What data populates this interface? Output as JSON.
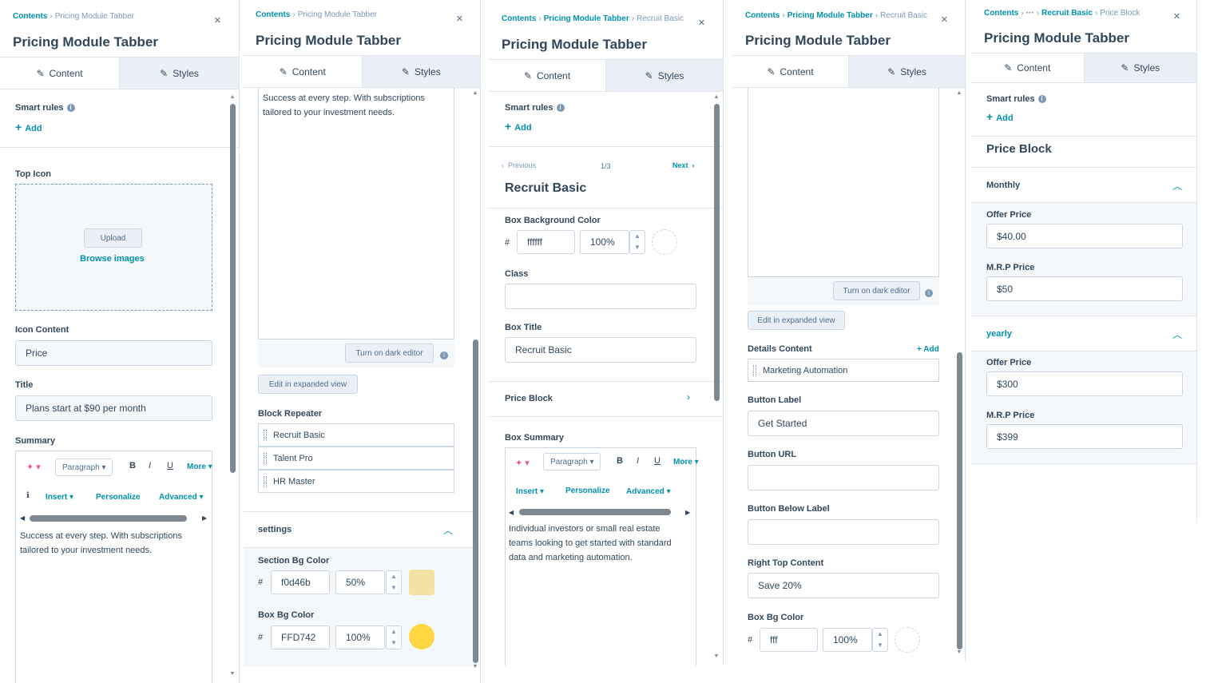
{
  "crumb_root": "Contents",
  "module_title": "Pricing Module Tabber",
  "tab_content": "Content",
  "tab_styles": "Styles",
  "smart_rules": "Smart rules",
  "add": "Add",
  "add_plus": "+ Add",
  "close_glyph": "×",
  "turn_on_dark_editor": "Turn on dark editor",
  "edit_expanded": "Edit in expanded view",
  "rte": {
    "paragraph": "Paragraph",
    "bold": "B",
    "italic": "I",
    "underline": "U",
    "more": "More",
    "insert": "Insert",
    "personalize": "Personalize",
    "advanced": "Advanced"
  },
  "panel1": {
    "top_icon_label": "Top Icon",
    "upload": "Upload",
    "browse_images": "Browse images",
    "icon_content_label": "Icon Content",
    "icon_content_value": "Price",
    "title_label": "Title",
    "title_value": "Plans start at $90 per month",
    "summary_label": "Summary",
    "summary_line1": "Success at every step. With subscriptions",
    "summary_line2": "tailored to your investment needs."
  },
  "panel2": {
    "summary_line1": "Success at every step. With subscriptions",
    "summary_line2": "tailored to your investment needs.",
    "block_repeater_label": "Block Repeater",
    "items": [
      "Recruit Basic",
      "Talent Pro",
      "HR Master"
    ],
    "settings_label": "settings",
    "section_bg_label": "Section Bg Color",
    "section_bg_hex": "f0d46b",
    "section_bg_opacity": "50%",
    "box_bg_label": "Box Bg Color",
    "box_bg_hex": "FFD742",
    "box_bg_opacity": "100%",
    "hash": "#",
    "colors": {
      "section_bg": "#f0d46b",
      "box_bg": "#ffd742"
    }
  },
  "panel3": {
    "crumb_current": "Recruit Basic",
    "previous": "Previous",
    "pager": "1/3",
    "next": "Next",
    "heading": "Recruit Basic",
    "box_bg_label": "Box Background Color",
    "box_bg_hex": "ffffff",
    "box_bg_opacity": "100%",
    "class_label": "Class",
    "class_value": "",
    "box_title_label": "Box Title",
    "box_title_value": "Recruit Basic",
    "price_block_label": "Price Block",
    "box_summary_label": "Box Summary",
    "summary_line1": "Individual investors or small real estate",
    "summary_line2": "teams looking to get started with standard",
    "summary_line3": "data and marketing automation.",
    "hash": "#"
  },
  "panel4": {
    "crumb_current": "Recruit Basic",
    "details_label": "Details Content",
    "details_item": "Marketing Automation",
    "button_label_label": "Button Label",
    "button_label_value": "Get Started",
    "button_url_label": "Button URL",
    "button_url_value": "",
    "button_below_label": "Button Below Label",
    "button_below_value": "",
    "right_top_label": "Right Top Content",
    "right_top_value": "Save 20%",
    "box_bg_label": "Box Bg Color",
    "box_bg_hex": "fff",
    "box_bg_opacity": "100%",
    "hash": "#"
  },
  "panel5": {
    "ellipsis": "···",
    "crumb_mid": "Recruit Basic",
    "crumb_current": "Price Block",
    "heading": "Price Block",
    "monthly_label": "Monthly",
    "monthly_offer_label": "Offer Price",
    "monthly_offer_value": "$40.00",
    "monthly_mrp_label": "M.R.P Price",
    "monthly_mrp_value": "$50",
    "yearly_label": "yearly",
    "yearly_offer_label": "Offer Price",
    "yearly_offer_value": "$300",
    "yearly_mrp_label": "M.R.P Price",
    "yearly_mrp_value": "$399"
  }
}
